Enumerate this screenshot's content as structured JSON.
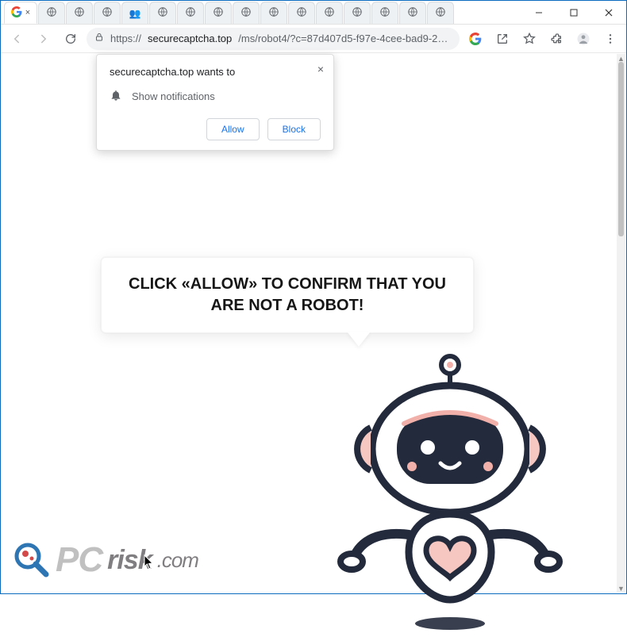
{
  "window": {
    "min": "—",
    "max": "▢",
    "close": "✕"
  },
  "tabs": {
    "count": 16,
    "active_favicon": "google-g-icon",
    "inactive_favicon": "globe-icon",
    "special_tab_index": 4
  },
  "toolbar": {
    "url_scheme": "https://",
    "url_host": "securecaptcha.top",
    "url_path": "/ms/robot4/?c=87d407d5-f97e-4cee-bad9-29ab5bd45b..."
  },
  "permission": {
    "title": "securecaptcha.top wants to",
    "body": "Show notifications",
    "allow": "Allow",
    "block": "Block"
  },
  "page": {
    "speech": "CLICK «ALLOW» TO CONFIRM THAT YOU ARE NOT A ROBOT!"
  },
  "watermark": {
    "pc": "PC",
    "risk": "risk",
    "dotcom": ".com"
  },
  "colors": {
    "robot_dark": "#232a3b",
    "robot_pink": "#f6c7c1",
    "robot_pink2": "#f2b0aa",
    "accent_blue": "#1a73e8"
  }
}
